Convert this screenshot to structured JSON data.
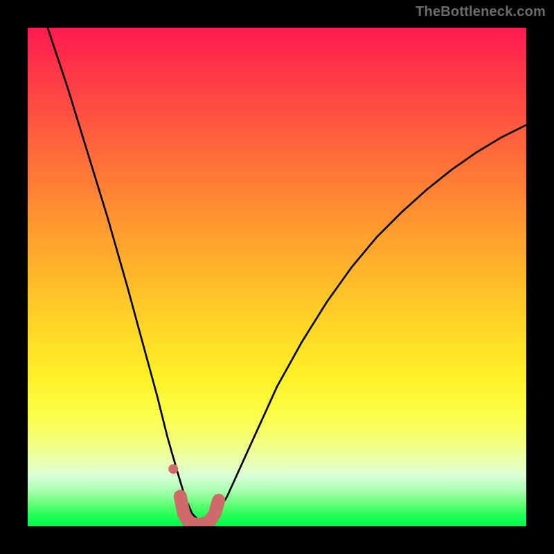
{
  "watermark": "TheBottleneck.com",
  "chart_data": {
    "type": "line",
    "title": "",
    "xlabel": "",
    "ylabel": "",
    "xlim": [
      0,
      100
    ],
    "ylim": [
      0,
      100
    ],
    "grid": false,
    "legend": false,
    "series": [
      {
        "name": "bottleneck-curve",
        "stroke": "#000000",
        "stroke_width": 2.7,
        "x": [
          4,
          8,
          12,
          16,
          20,
          23,
          26,
          28,
          30,
          31.5,
          33,
          34.5,
          36,
          38,
          40,
          45,
          50,
          55,
          60,
          65,
          70,
          75,
          80,
          85,
          90,
          95,
          100
        ],
        "y": [
          100,
          88,
          75,
          62,
          48,
          37,
          26,
          18,
          11,
          6,
          2.5,
          1,
          1,
          2.5,
          6,
          17,
          28,
          37,
          45,
          52,
          58,
          63,
          67.5,
          71.5,
          75,
          78,
          80.5
        ]
      },
      {
        "name": "trough-marker",
        "stroke": "#cf6a6a",
        "stroke_width": 19,
        "linecap": "round",
        "x": [
          30.6,
          31.3,
          32.3,
          33.5,
          35.0,
          36.4,
          37.5,
          38.3
        ],
        "y": [
          6.0,
          2.5,
          0.9,
          0.4,
          0.4,
          0.9,
          2.5,
          5.2
        ]
      },
      {
        "name": "trough-marker-dot",
        "type": "scatter",
        "fill": "#cf6a6a",
        "radius": 7,
        "x": [
          29.2
        ],
        "y": [
          11.5
        ]
      }
    ],
    "background_gradient": {
      "top": "#ff1a50",
      "mid": "#fff127",
      "bottom": "#00f84a"
    }
  }
}
